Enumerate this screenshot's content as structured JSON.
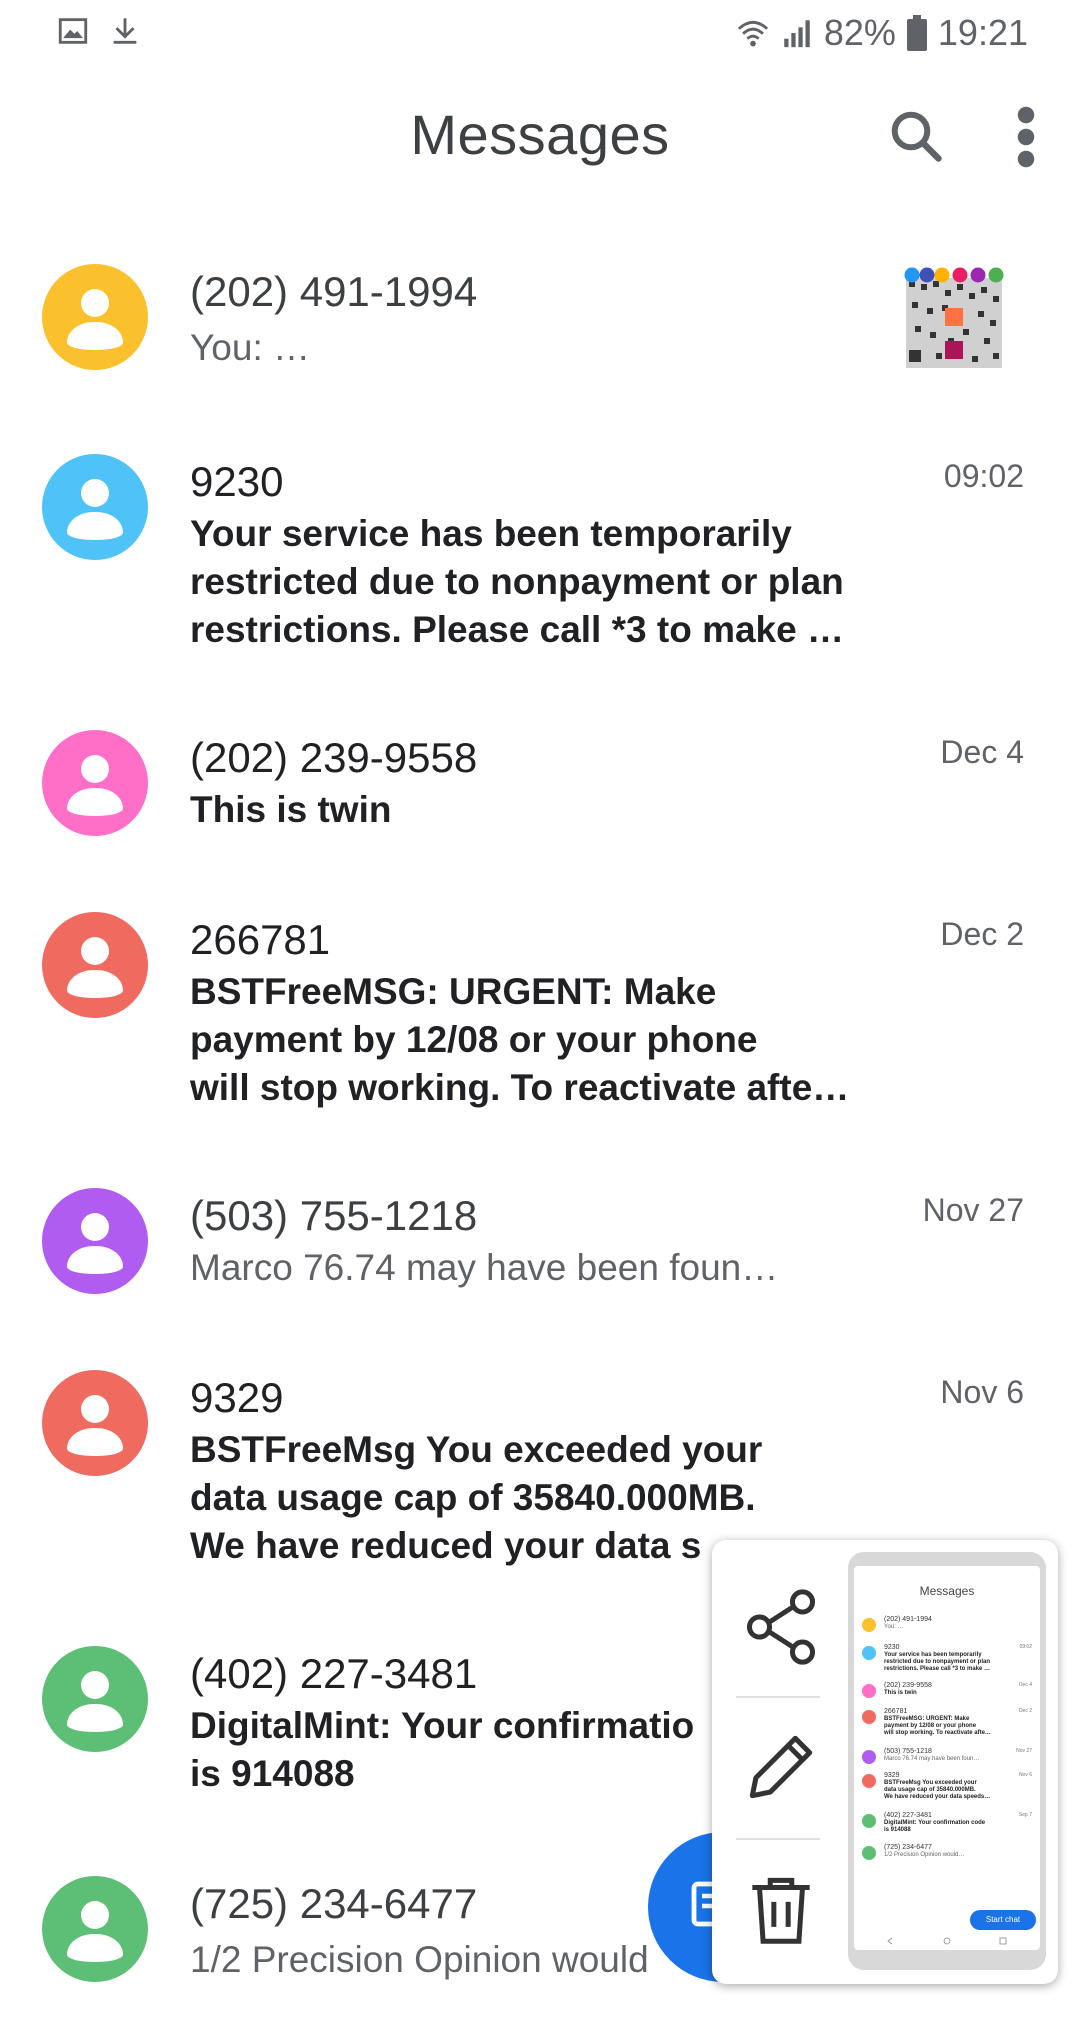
{
  "status_bar": {
    "battery": "82%",
    "time": "19:21",
    "icons_left": [
      "gallery-icon",
      "download-icon"
    ],
    "icons_right": [
      "wifi-icon",
      "signal-icon",
      "battery-icon"
    ]
  },
  "app_bar": {
    "title": "Messages",
    "search_icon": "search-icon",
    "more_icon": "more-vert-icon"
  },
  "conversations": [
    {
      "name": "(202) 491-1994",
      "snippet": "You: …",
      "time": "",
      "avatar_color": "#FBC02D",
      "unread": false,
      "has_image": true
    },
    {
      "name": "9230",
      "snippet": "Your service has been temporarily\nrestricted due to nonpayment or plan\nrestrictions. Please call *3 to make …",
      "time": "09:02",
      "avatar_color": "#4FC3F7",
      "unread": true
    },
    {
      "name": "(202) 239-9558",
      "snippet": "This is twin",
      "time": "Dec 4",
      "avatar_color": "#FF6EC7",
      "unread": true
    },
    {
      "name": "266781",
      "snippet": "BSTFreeMSG: URGENT: Make\npayment by 12/08 or your phone\nwill stop working. To reactivate afte…",
      "time": "Dec 2",
      "avatar_color": "#EF6A5F",
      "unread": true
    },
    {
      "name": "(503) 755-1218",
      "snippet": "Marco   76.74 may have been foun…",
      "time": "Nov 27",
      "avatar_color": "#B15CF0",
      "unread": false
    },
    {
      "name": "9329",
      "snippet": "BSTFreeMsg You exceeded your\ndata usage cap of 35840.000MB.\nWe have reduced your data s",
      "time": "Nov 6",
      "avatar_color": "#EF6A5F",
      "unread": true
    },
    {
      "name": "(402) 227-3481",
      "snippet": "DigitalMint: Your confirmatio\nis 914088",
      "time": "",
      "avatar_color": "#5CBF75",
      "unread": true
    },
    {
      "name": "(725) 234-6477",
      "snippet": "1/2 Precision Opinion would",
      "time": "",
      "avatar_color": "#5CBF75",
      "unread": false
    }
  ],
  "fab": {
    "icon": "start-chat-icon"
  },
  "screenshot_panel": {
    "actions": [
      "share-icon",
      "edit-icon",
      "delete-icon"
    ],
    "thumbnail": {
      "title": "Messages",
      "rows": [
        {
          "name": "(202) 491-1994",
          "snippet": "You: …",
          "time": "",
          "color": "#FBC02D"
        },
        {
          "name": "9230",
          "snippet": "Your service has been temporarily\nrestricted due to nonpayment or plan\nrestrictions. Please call *3 to make …",
          "time": "09:02",
          "color": "#4FC3F7"
        },
        {
          "name": "(202) 239-9558",
          "snippet": "This is twin",
          "time": "Dec 4",
          "color": "#FF6EC7"
        },
        {
          "name": "266781",
          "snippet": "BSTFreeMSG: URGENT: Make\npayment by 12/08 or your phone\nwill stop working. To reactivate afte…",
          "time": "Dec 2",
          "color": "#EF6A5F"
        },
        {
          "name": "(503) 755-1218",
          "snippet": "Marco   76.74 may have been foun…",
          "time": "Nov 27",
          "color": "#B15CF0"
        },
        {
          "name": "9329",
          "snippet": "BSTFreeMsg You exceeded your\ndata usage cap of 35840.000MB.\nWe have reduced your data speeds…",
          "time": "Nov 6",
          "color": "#EF6A5F"
        },
        {
          "name": "(402) 227-3481",
          "snippet": "DigitalMint: Your confirmation code\nis 914088",
          "time": "Sep 7",
          "color": "#5CBF75"
        },
        {
          "name": "(725) 234-6477",
          "snippet": "1/2 Precision Opinion would…",
          "time": "",
          "color": "#5CBF75"
        }
      ],
      "chip_label": "Start chat"
    }
  }
}
